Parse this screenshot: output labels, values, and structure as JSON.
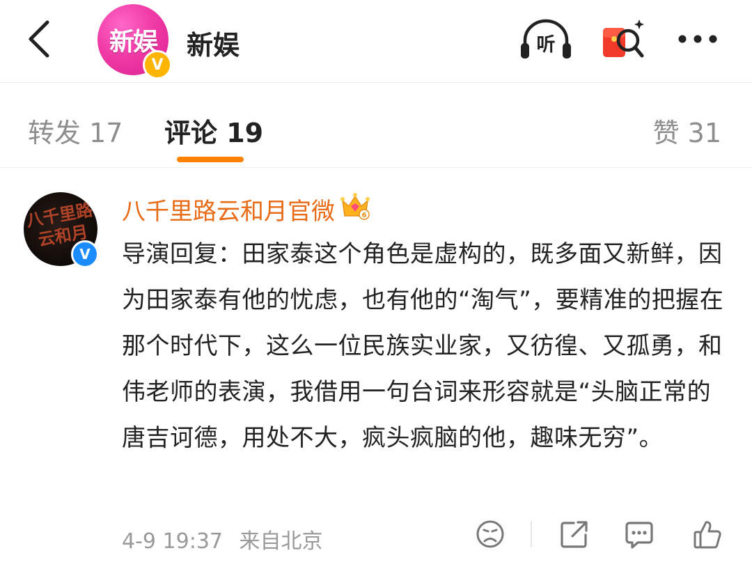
{
  "header": {
    "avatar_logo": "新娱",
    "verified_badge": "V",
    "title": "新娱",
    "listen_label": "听"
  },
  "tabs": [
    {
      "label": "转发 17"
    },
    {
      "label": "评论 19"
    },
    {
      "label": "赞 31"
    }
  ],
  "comment": {
    "user_name": "八千里路云和月官微",
    "avatar_text": "八千里路云和月",
    "verified_badge": "V",
    "text": "导演回复：田家泰这个角色是虚构的，既多面又新鲜，因为田家泰有他的忧虑，也有他的“淘气”，要精准的把握在那个时代下，这么一位民族实业家，又彷徨、又孤勇，和伟老师的表演，我借用一句台词来形容就是“头脑正常的唐吉诃德，用处不大，疯头疯脑的他，趣味无穷”。",
    "time": "4-9 19:37",
    "location": "来自北京",
    "crown_level": "6"
  },
  "colors": {
    "accent": "#ff8200",
    "username": "#e86b17",
    "muted": "#999999",
    "verified_gold": "#ffb400",
    "verified_blue": "#1a8cff"
  },
  "icons": [
    "back-arrow-icon",
    "listen-headphone-icon",
    "red-packet-search-icon",
    "more-icon",
    "crown-badge-icon",
    "dislike-face-icon",
    "share-icon",
    "comment-icon",
    "like-icon"
  ]
}
